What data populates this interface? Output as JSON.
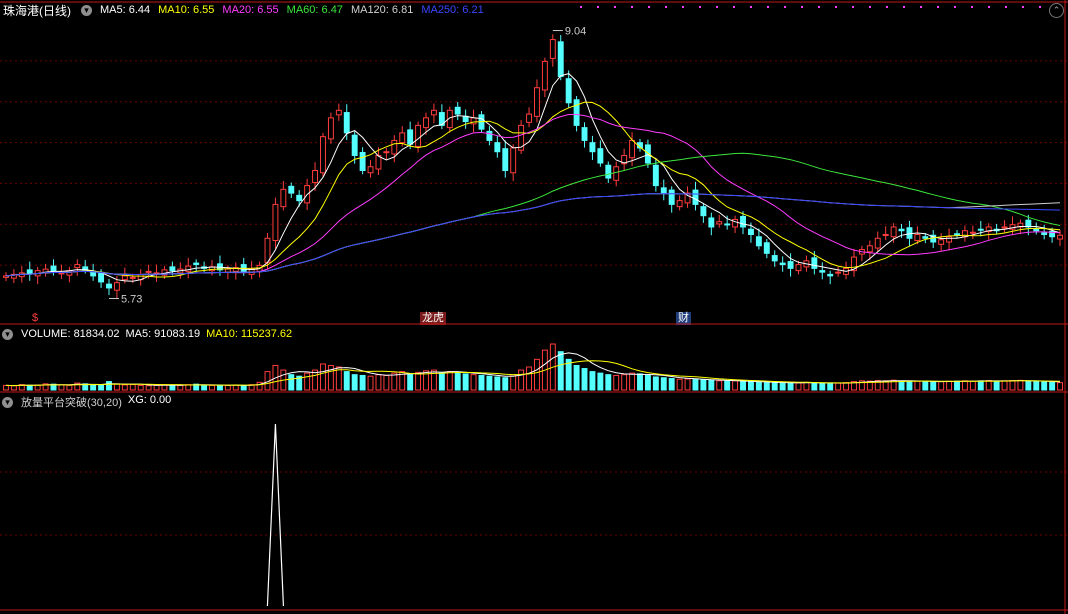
{
  "colors": {
    "up": "#ff3d3d",
    "down": "#54ffff",
    "ma5": "#ffffff",
    "ma10": "#ffff00",
    "ma20": "#ff3cff",
    "ma60": "#3ce63c",
    "ma120": "#cfcfcf",
    "ma250": "#3a46ff",
    "grid": "#6b0000",
    "divider": "#c01818"
  },
  "header": {
    "stock_name": "珠海港(日线)",
    "ma": [
      {
        "label": "MA5: 6.44",
        "color": "#ffffff"
      },
      {
        "label": "MA10: 6.55",
        "color": "#ffff00"
      },
      {
        "label": "MA20: 6.55",
        "color": "#ff3cff"
      },
      {
        "label": "MA60: 6.47",
        "color": "#3ce63c"
      },
      {
        "label": "MA120: 6.81",
        "color": "#cfcfcf"
      },
      {
        "label": "MA250: 6.21",
        "color": "#3a46ff"
      }
    ]
  },
  "annotations": {
    "high": "9.04",
    "low": "5.73",
    "marker_s": "$",
    "marker_lhb": "龙虎",
    "marker_cai": "财"
  },
  "volume_header": {
    "items": [
      {
        "label": "VOLUME: 81834.02",
        "color": "#ffffff"
      },
      {
        "label": "MA5: 91083.19",
        "color": "#ffffff"
      },
      {
        "label": "MA10: 115237.62",
        "color": "#ffff00"
      }
    ]
  },
  "indicator_header": {
    "items": [
      {
        "label": "放量平台突破(30,20)",
        "color": "#cfcfcf"
      },
      {
        "label": "XG: 0.00",
        "color": "#ffffff"
      }
    ]
  },
  "chart_data": {
    "type": "candlestick",
    "y_range_price": [
      5.5,
      9.3
    ],
    "closes": [
      5.9,
      5.92,
      5.94,
      5.93,
      5.97,
      5.99,
      5.97,
      5.94,
      5.97,
      6.05,
      5.98,
      5.9,
      5.82,
      5.74,
      5.81,
      5.9,
      5.88,
      5.92,
      5.96,
      5.94,
      5.98,
      5.97,
      5.99,
      6.03,
      6.05,
      6.0,
      6.02,
      5.98,
      5.99,
      6.01,
      5.95,
      5.99,
      6.04,
      6.4,
      6.85,
      7.05,
      7.0,
      6.9,
      7.1,
      7.3,
      7.75,
      8.0,
      8.1,
      7.8,
      7.5,
      7.3,
      7.35,
      7.5,
      7.55,
      7.7,
      7.8,
      7.65,
      7.9,
      8.0,
      8.1,
      7.9,
      8.1,
      8.05,
      7.95,
      8.0,
      7.85,
      7.7,
      7.55,
      7.3,
      7.6,
      7.9,
      8.05,
      8.4,
      8.75,
      9.04,
      8.55,
      8.2,
      7.9,
      7.7,
      7.55,
      7.4,
      7.2,
      7.35,
      7.5,
      7.7,
      7.6,
      7.4,
      7.1,
      7.0,
      6.85,
      6.9,
      7.0,
      6.85,
      6.7,
      6.55,
      6.62,
      6.58,
      6.65,
      6.55,
      6.45,
      6.3,
      6.2,
      6.1,
      6.05,
      6.0,
      6.05,
      6.1,
      6.0,
      5.95,
      5.9,
      5.95,
      6.0,
      6.15,
      6.25,
      6.3,
      6.4,
      6.45,
      6.55,
      6.5,
      6.4,
      6.45,
      6.4,
      6.35,
      6.38,
      6.42,
      6.45,
      6.5,
      6.48,
      6.52,
      6.55,
      6.5,
      6.55,
      6.58,
      6.6,
      6.55,
      6.5,
      6.45,
      6.42,
      6.44
    ],
    "volumes": [
      30,
      28,
      35,
      30,
      32,
      40,
      38,
      33,
      30,
      45,
      40,
      35,
      30,
      55,
      40,
      33,
      35,
      30,
      28,
      30,
      35,
      33,
      30,
      35,
      38,
      32,
      30,
      28,
      30,
      33,
      30,
      35,
      50,
      120,
      160,
      130,
      100,
      90,
      110,
      130,
      170,
      160,
      150,
      120,
      100,
      95,
      90,
      100,
      95,
      110,
      120,
      100,
      115,
      125,
      130,
      110,
      120,
      115,
      105,
      100,
      95,
      90,
      85,
      80,
      100,
      130,
      150,
      200,
      260,
      300,
      250,
      200,
      160,
      140,
      120,
      110,
      100,
      95,
      100,
      110,
      105,
      95,
      85,
      80,
      75,
      70,
      72,
      68,
      65,
      62,
      60,
      58,
      60,
      55,
      52,
      50,
      48,
      47,
      46,
      45,
      47,
      50,
      46,
      44,
      43,
      45,
      48,
      55,
      60,
      58,
      62,
      60,
      64,
      58,
      55,
      57,
      55,
      53,
      55,
      57,
      58,
      60,
      58,
      60,
      62,
      58,
      60,
      62,
      63,
      58,
      55,
      52,
      50,
      48
    ],
    "xg_signal_index": 34
  }
}
